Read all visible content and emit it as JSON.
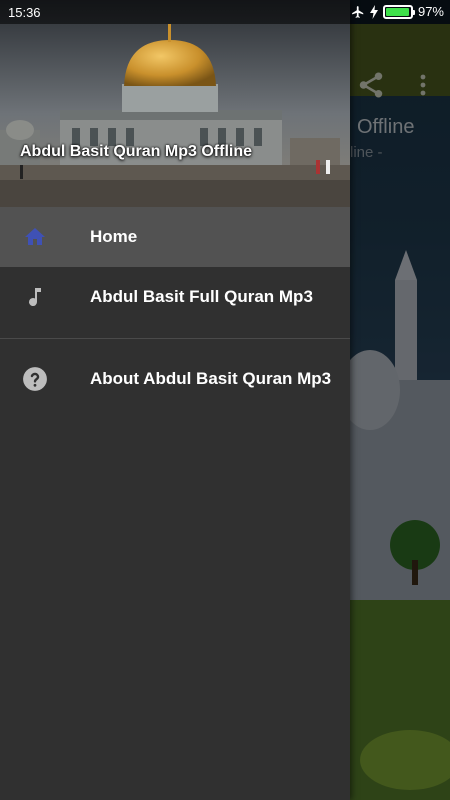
{
  "status_bar": {
    "time": "15:36",
    "battery": "97%",
    "battery_level": 0.97
  },
  "background_app": {
    "title": "Offline",
    "subtitle": "line -",
    "toolbar_color": "#4b5a20"
  },
  "drawer": {
    "header_title": "Abdul Basit Quran Mp3 Offline",
    "items": [
      {
        "label": "Home",
        "icon": "home-icon",
        "active": true
      },
      {
        "label": "Abdul Basit Full Quran Mp3",
        "icon": "music-note-icon",
        "active": false
      },
      {
        "label": "About Abdul Basit Quran Mp3",
        "icon": "help-circle-icon",
        "active": false
      }
    ]
  },
  "colors": {
    "accent": "#3f51b5",
    "drawer_bg": "#303030",
    "active_item_bg": "#525252"
  }
}
